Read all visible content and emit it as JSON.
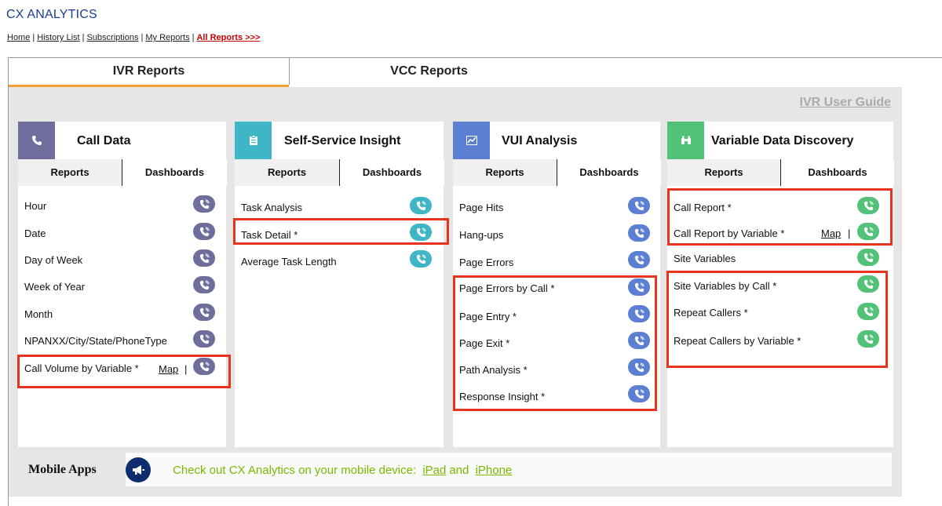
{
  "app": {
    "title": "CX ANALYTICS"
  },
  "nav": {
    "home": "Home",
    "history": "History List",
    "subscriptions": "Subscriptions",
    "my_reports": "My Reports",
    "all_reports": "All Reports >>>",
    "separator": "|"
  },
  "tabs": {
    "ivr": "IVR Reports",
    "vcc": "VCC Reports"
  },
  "guide": "IVR User Guide",
  "panels": {
    "call_data": {
      "title": "Call Data",
      "reports": "Reports",
      "dashboards": "Dashboards",
      "color": "#6f6d9c",
      "map_label": "Map",
      "map_sep": "|",
      "items": [
        "Hour",
        "Date",
        "Day of Week",
        "Week of Year",
        "Month",
        "NPANXX/City/State/PhoneType",
        "Call Volume by Variable *"
      ]
    },
    "self_service": {
      "title": "Self-Service Insight",
      "reports": "Reports",
      "dashboards": "Dashboards",
      "color": "#3fb6c6",
      "items": [
        "Task Analysis",
        "Task Detail *",
        "Average Task Length"
      ]
    },
    "vui": {
      "title": "VUI Analysis",
      "reports": "Reports",
      "dashboards": "Dashboards",
      "color": "#5c7fd4",
      "items": [
        "Page Hits",
        "Hang-ups",
        "Page Errors",
        "Page Errors by Call *",
        "Page Entry *",
        "Page Exit *",
        "Path Analysis *",
        "Response Insight *"
      ]
    },
    "vdd": {
      "title": "Variable Data Discovery",
      "reports": "Reports",
      "dashboards": "Dashboards",
      "color": "#52c279",
      "map_label": "Map",
      "map_sep": "|",
      "items": [
        "Call Report *",
        "Call Report by Variable *",
        "Site Variables",
        "Site Variables by Call *",
        "Repeat Callers *",
        "Repeat Callers by Variable *"
      ]
    }
  },
  "mobile": {
    "label": "Mobile Apps",
    "text": "Check out CX Analytics on your mobile device:",
    "ipad": "iPad",
    "and": "and",
    "iphone": "iPhone"
  }
}
